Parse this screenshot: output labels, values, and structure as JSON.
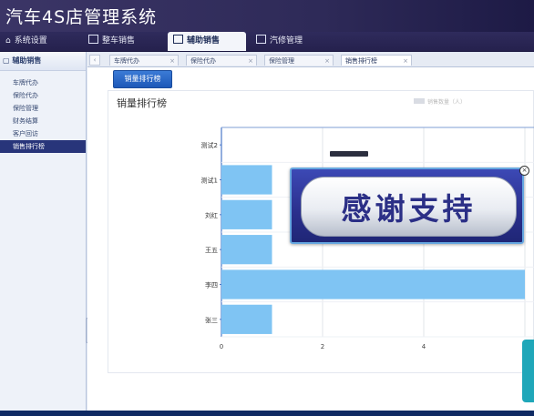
{
  "app": {
    "title": "汽车4S店管理系统"
  },
  "menu": {
    "home": "系统设置",
    "items": [
      "整车销售",
      "辅助销售",
      "汽修管理"
    ]
  },
  "sidebar": {
    "header": "辅助销售",
    "items": [
      "车牌代办",
      "保险代办",
      "保险管理",
      "财务结算",
      "客户回访",
      "销售排行榜"
    ]
  },
  "tabs": [
    {
      "label": "车牌代办",
      "close": "×"
    },
    {
      "label": "保险代办",
      "close": "×"
    },
    {
      "label": "保险管理",
      "close": "×"
    },
    {
      "label": "销售排行榜",
      "close": "×"
    }
  ],
  "toolbar": {
    "rank_button": "销量排行榜"
  },
  "chart_data": {
    "type": "bar",
    "orientation": "horizontal",
    "title": "销量排行榜",
    "legend": "销售数量（人）",
    "categories": [
      "测试2",
      "测试1",
      "刘红",
      "王五",
      "李四",
      "张三"
    ],
    "values": [
      0,
      1,
      1,
      1,
      6,
      1
    ],
    "xticks": [
      "0",
      "2",
      "4"
    ],
    "xlim": [
      0,
      6.2
    ],
    "bar_color": "#7fc4f3"
  },
  "overlay": {
    "thanks": "感谢支持",
    "close_icon": "close-circle-icon"
  },
  "colors": {
    "accent": "#28357a",
    "button": "#2a64c4"
  }
}
